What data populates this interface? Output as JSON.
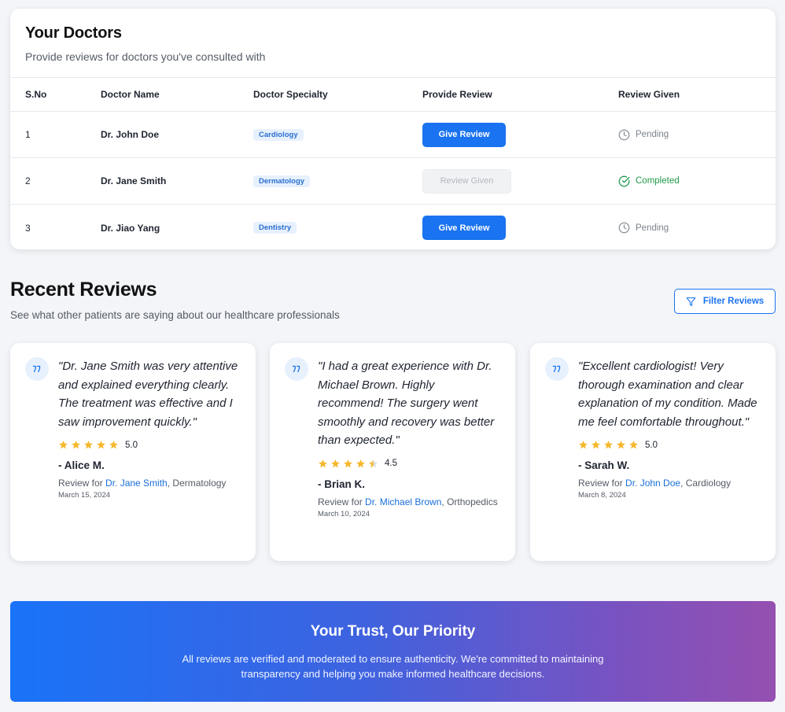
{
  "doctors": {
    "title": "Your Doctors",
    "subtitle": "Provide reviews for doctors you've consulted with",
    "columns": [
      "S.No",
      "Doctor Name",
      "Doctor Specialty",
      "Provide Review",
      "Review Given"
    ],
    "rows": [
      {
        "sno": "1",
        "name": "Dr. John Doe",
        "specialty": "Cardiology",
        "action": "Give Review",
        "action_state": "enabled",
        "status": "Pending",
        "status_type": "pending"
      },
      {
        "sno": "2",
        "name": "Dr. Jane Smith",
        "specialty": "Dermatology",
        "action": "Review Given",
        "action_state": "disabled",
        "status": "Completed",
        "status_type": "completed"
      },
      {
        "sno": "3",
        "name": "Dr. Jiao Yang",
        "specialty": "Dentistry",
        "action": "Give Review",
        "action_state": "enabled",
        "status": "Pending",
        "status_type": "pending"
      }
    ]
  },
  "reviews": {
    "title": "Recent Reviews",
    "subtitle": "See what other patients are saying about our healthcare professionals",
    "filter_label": "Filter Reviews",
    "filter_icon": "filter-icon",
    "review_for_prefix": "Review for",
    "items": [
      {
        "quote": "\"Dr. Jane Smith was very attentive and explained everything clearly. The treatment was effective and I saw improvement quickly.\"",
        "rating": 5.0,
        "score": "5.0",
        "author": "- Alice M.",
        "doctor": "Dr. Jane Smith",
        "specialty": ", Dermatology",
        "date": "March 15, 2024"
      },
      {
        "quote": "\"I had a great experience with Dr. Michael Brown. Highly recommend! The surgery went smoothly and recovery was better than expected.\"",
        "rating": 4.5,
        "score": "4.5",
        "author": "- Brian K.",
        "doctor": "Dr. Michael Brown",
        "specialty": ", Orthopedics",
        "date": "March 10, 2024"
      },
      {
        "quote": "\"Excellent cardiologist! Very thorough examination and clear explanation of my condition. Made me feel comfortable throughout.\"",
        "rating": 5.0,
        "score": "5.0",
        "author": "- Sarah W.",
        "doctor": "Dr. John Doe",
        "specialty": ", Cardiology",
        "date": "March 8, 2024"
      }
    ]
  },
  "trust": {
    "title": "Your Trust, Our Priority",
    "text": "All reviews are verified and moderated to ensure authenticity. We're committed to maintaining transparency and helping you make informed healthcare decisions."
  },
  "colors": {
    "primary": "#1a73f0",
    "completed": "#1f9a4a",
    "pending": "#7c828c",
    "star": "#f5b82e",
    "star_empty": "#d9dce1"
  }
}
